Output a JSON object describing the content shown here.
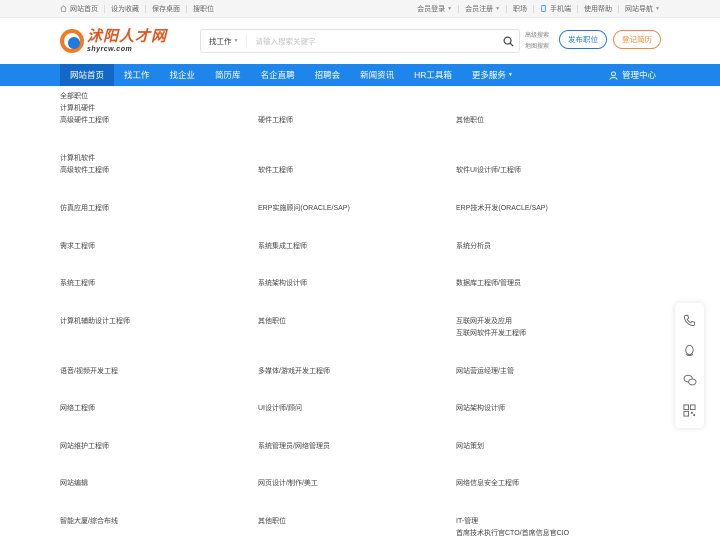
{
  "topbar": {
    "left": [
      "网站首页",
      "设为收藏",
      "保存桌面",
      "搜职位"
    ],
    "right": [
      "会员登录",
      "会员注册",
      "职场",
      "手机端",
      "使用帮助",
      "网站导航"
    ]
  },
  "logo": {
    "cn": "沭阳人才网",
    "en": "shyrcw.com"
  },
  "search": {
    "type_label": "找工作",
    "placeholder": "请输入搜索关键字",
    "links": [
      "高级搜索",
      "地图搜索"
    ]
  },
  "header_buttons": {
    "post": "发布职位",
    "resume": "登记简历"
  },
  "nav": {
    "items": [
      "网站首页",
      "找工作",
      "找企业",
      "简历库",
      "名企直聘",
      "招聘会",
      "新闻资讯",
      "HR工具箱",
      "更多服务"
    ],
    "admin": "管理中心"
  },
  "content": {
    "all_label": "全部职位",
    "categories": [
      {
        "title": "计算机硬件",
        "rows": [
          [
            "高级硬件工程师",
            "硬件工程师",
            "其他职位"
          ]
        ]
      },
      {
        "title": "计算机软件",
        "rows": [
          [
            "高级软件工程师",
            "软件工程师",
            "软件UI设计师/工程师"
          ],
          [
            "仿真应用工程师",
            "ERP实施顾问(ORACLE/SAP)",
            "ERP技术开发(ORACLE/SAP)"
          ],
          [
            "需求工程师",
            "系统集成工程师",
            "系统分析员"
          ],
          [
            "系统工程师",
            "系统架构设计师",
            "数据库工程师/管理员"
          ],
          [
            "计算机辅助设计工程师",
            "其他职位",
            ""
          ]
        ]
      },
      {
        "title": "互联网开发及应用",
        "rows": [
          [
            "互联网软件开发工程师",
            "",
            ""
          ],
          [
            "语音/视频开发工程",
            "多媒体/游戏开发工程师",
            "网站营运经理/主管"
          ],
          [
            "网络工程师",
            "UI设计师/顾问",
            "网站架构设计师"
          ],
          [
            "网站维护工程师",
            "系统管理员/网络管理员",
            "网站策划"
          ],
          [
            "网站编辑",
            "网页设计/制作/美工",
            "网络信息安全工程师"
          ],
          [
            "智能大厦/综合布线",
            "其他职位",
            ""
          ]
        ]
      },
      {
        "title": "IT-管理",
        "rows": [
          [
            "首席技术执行官CTO/首席信息官CIO",
            "",
            ""
          ]
        ]
      }
    ]
  },
  "float_bar": [
    "phone-icon",
    "qq-icon",
    "wechat-icon",
    "qrcode-icon"
  ]
}
